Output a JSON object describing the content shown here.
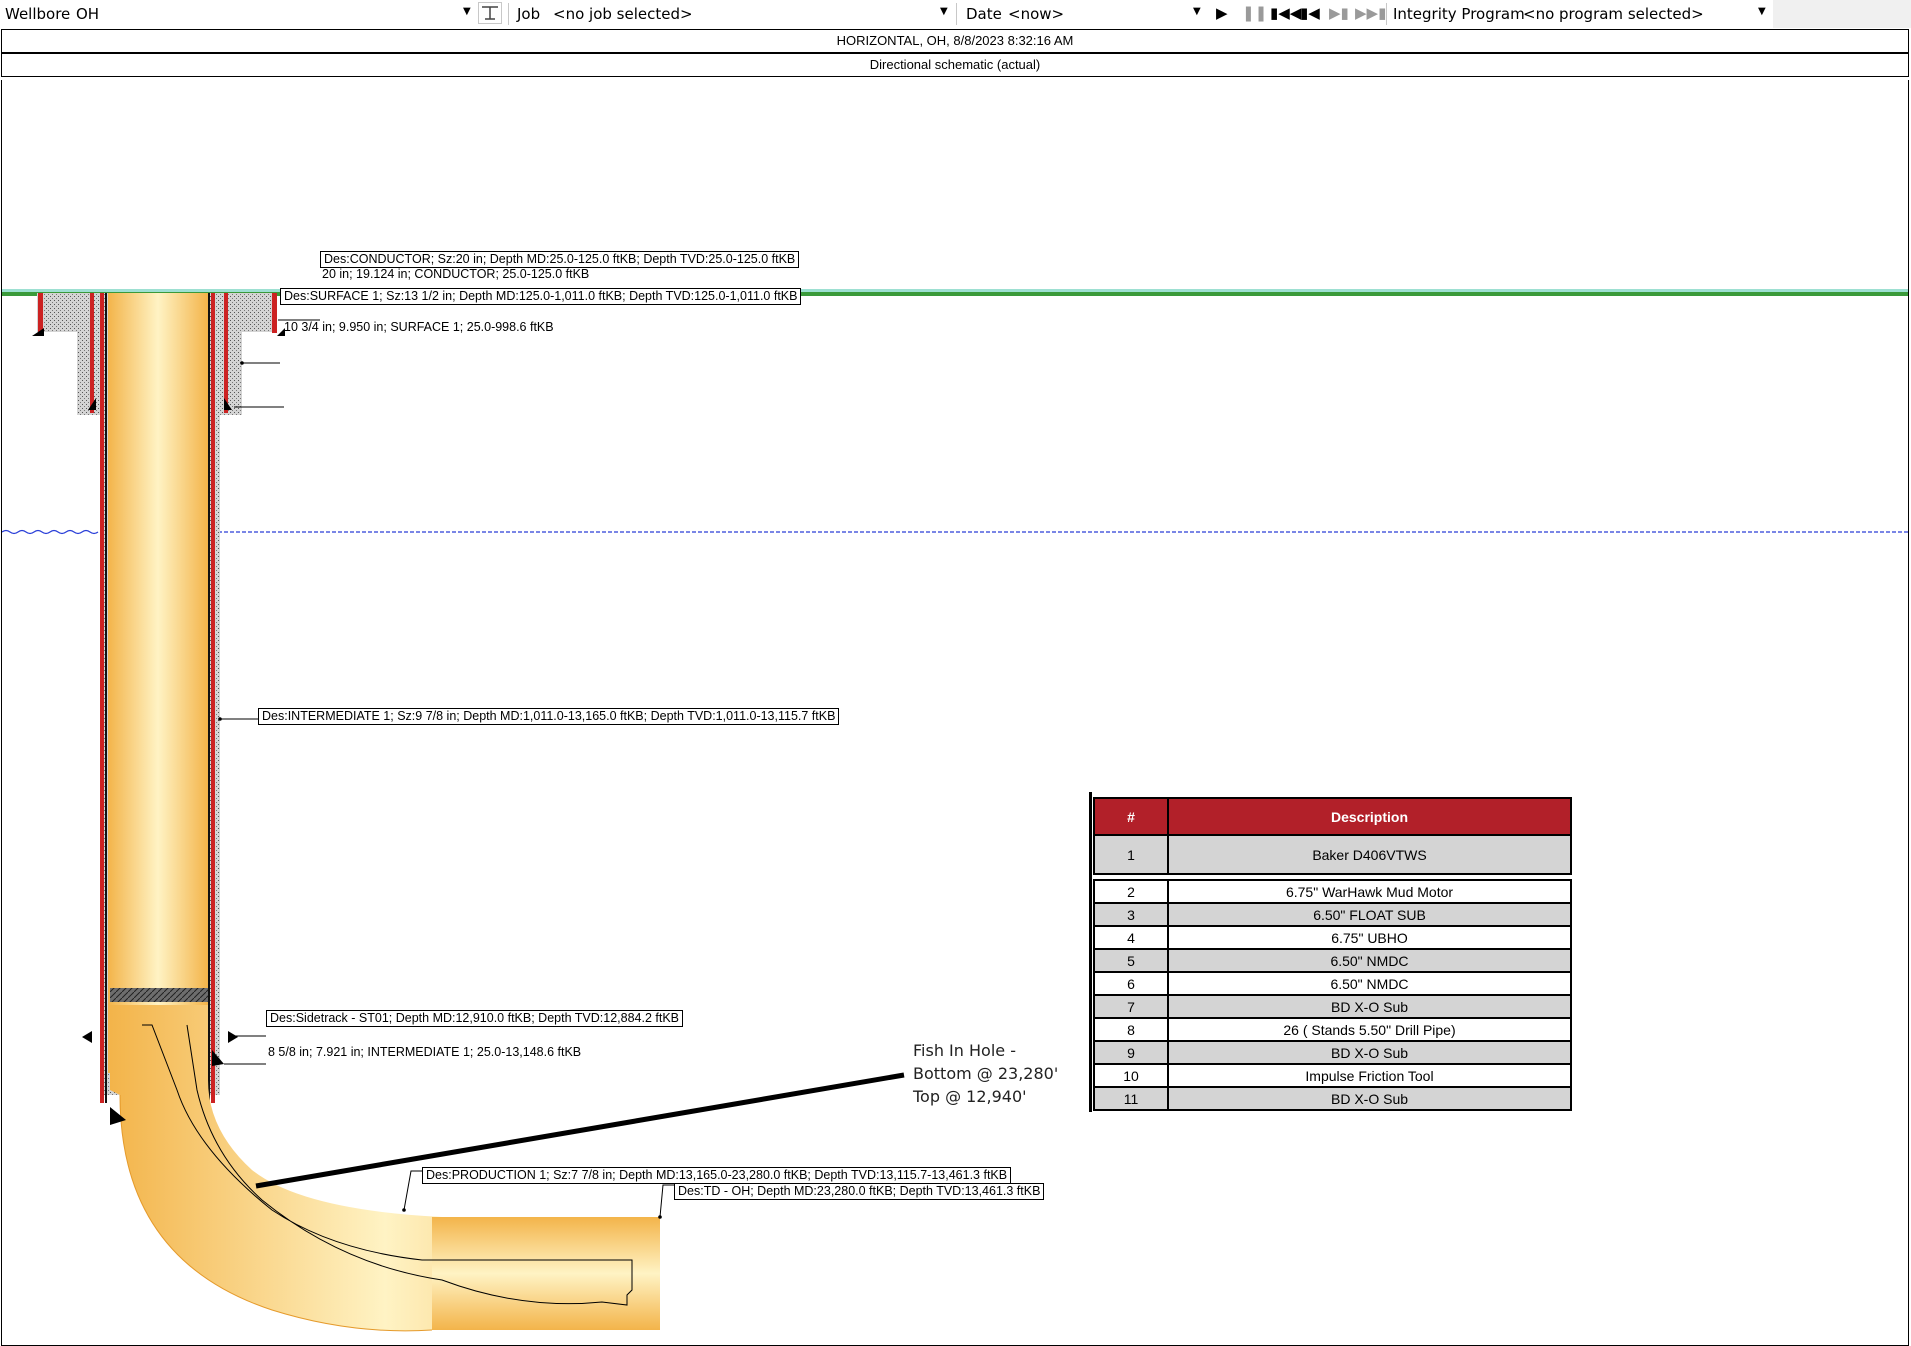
{
  "toolbar": {
    "wellbore_label": "Wellbore",
    "wellbore_value": "OH",
    "job_label": "Job",
    "job_value": "<no job selected>",
    "date_label": "Date",
    "date_value": "<now>",
    "integrity_label": "Integrity Program",
    "integrity_value": "<no program selected>"
  },
  "header": {
    "title": "HORIZONTAL, OH, 8/8/2023 8:32:16 AM",
    "subtitle": "Directional schematic (actual)"
  },
  "labels": {
    "conductor": "Des:CONDUCTOR;  Sz:20 in;  Depth MD:25.0-125.0 ftKB;  Depth TVD:25.0-125.0 ftKB",
    "conductor_size": "20 in; 19.124 in; CONDUCTOR; 25.0-125.0 ftKB",
    "surface": "Des:SURFACE 1;  Sz:13 1/2 in;  Depth MD:125.0-1,011.0 ftKB;  Depth TVD:125.0-1,011.0 ftKB",
    "surface_size": "10 3/4 in; 9.950 in; SURFACE 1; 25.0-998.6 ftKB",
    "intermediate": "Des:INTERMEDIATE 1;  Sz:9 7/8 in;  Depth MD:1,011.0-13,165.0 ftKB;  Depth TVD:1,011.0-13,115.7 ftKB",
    "sidetrack": "Des:Sidetrack - ST01;  Depth MD:12,910.0 ftKB;  Depth TVD:12,884.2 ftKB",
    "intermediate_size": "8 5/8 in; 7.921 in; INTERMEDIATE 1;  25.0-13,148.6 ftKB",
    "production": "Des:PRODUCTION 1;  Sz:7 7/8 in;  Depth MD:13,165.0-23,280.0 ftKB;  Depth TVD:13,115.7-13,461.3 ftKB",
    "td": "Des:TD - OH;  Depth MD:23,280.0 ftKB;  Depth TVD:13,461.3 ftKB"
  },
  "fish": {
    "line1": "Fish In Hole -",
    "line2": "Bottom @ 23,280'",
    "line3": "Top @ 12,940'"
  },
  "bha_table": {
    "headers": [
      "#",
      "Description"
    ],
    "rows": [
      [
        "1",
        "Baker D406VTWS"
      ],
      [
        "2",
        "6.75\" WarHawk Mud Motor"
      ],
      [
        "3",
        "6.50\" FLOAT SUB"
      ],
      [
        "4",
        "6.75\" UBHO"
      ],
      [
        "5",
        "6.50\" NMDC"
      ],
      [
        "6",
        "6.50\" NMDC"
      ],
      [
        "7",
        "BD X-O Sub"
      ],
      [
        "8",
        "26 ( Stands 5.50\" Drill Pipe)"
      ],
      [
        "9",
        "BD X-O Sub"
      ],
      [
        "10",
        "Impulse Friction Tool"
      ],
      [
        "11",
        "BD X-O Sub"
      ]
    ]
  },
  "colors": {
    "header_red": "#b22029",
    "casing_red": "#cc2222",
    "hole_fill": "#f9d27a",
    "cement": "#bdbdbd",
    "ground_green": "#3a9a3a",
    "water_blue": "#2a3fd8"
  }
}
